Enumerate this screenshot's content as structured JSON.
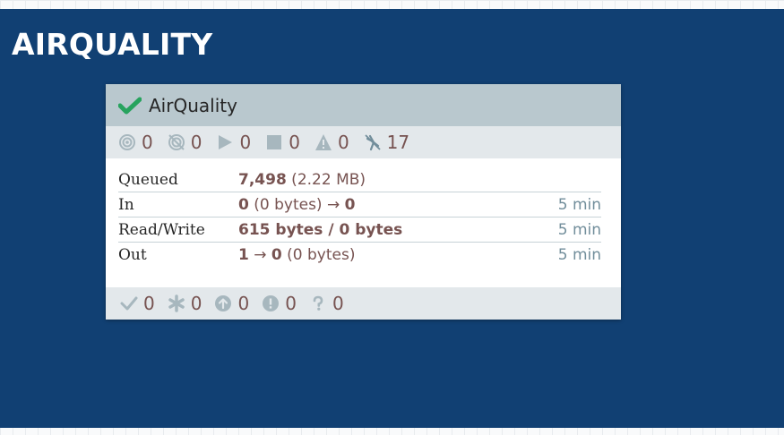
{
  "group": {
    "title": "AIRQUALITY",
    "background": "#114073"
  },
  "card": {
    "name": "AirQuality",
    "status_ok": true,
    "status": {
      "transmitting": "0",
      "not_transmitting": "0",
      "running": "0",
      "stopped": "0",
      "invalid": "0",
      "disabled": "17"
    },
    "metrics": [
      {
        "label": "Queued",
        "value_bold": "7,498",
        "value_rest": " (2.22 MB)",
        "time": ""
      },
      {
        "label": "In",
        "value_bold": "0",
        "value_rest": " (0 bytes) → ",
        "value_bold2": "0",
        "time": "5 min"
      },
      {
        "label": "Read/Write",
        "value_bold": "615 bytes / 0 bytes",
        "value_rest": "",
        "time": "5 min"
      },
      {
        "label": "Out",
        "value_bold": "1",
        "value_rest": " → ",
        "value_bold2": "0",
        "value_rest2": " (0 bytes)",
        "time": "5 min"
      }
    ],
    "footer": {
      "up_to_date": "0",
      "locally_modified": "0",
      "stale": "0",
      "sync_failure": "0",
      "unknown": "0"
    }
  },
  "colors": {
    "accent_green": "#27a35e",
    "icon_gray": "#a7b7be",
    "value_brown": "#775351"
  }
}
